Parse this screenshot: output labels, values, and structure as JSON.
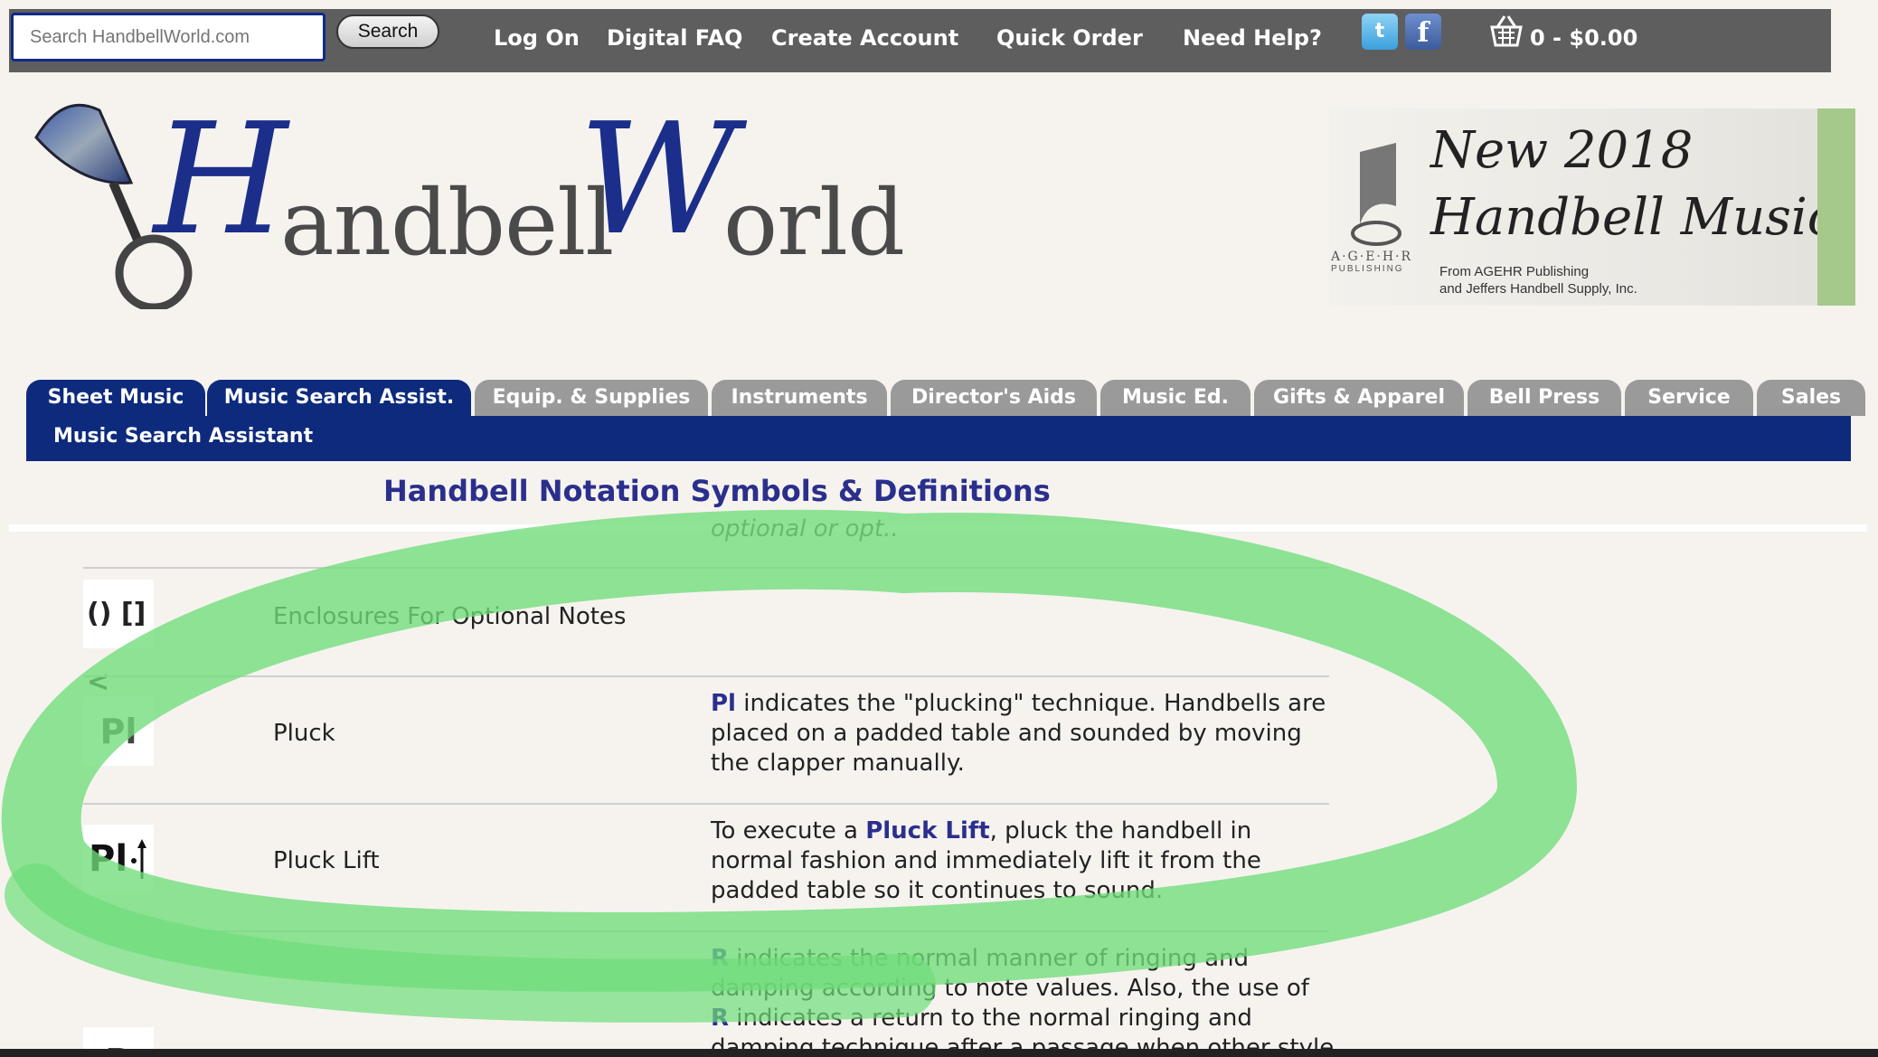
{
  "topbar": {
    "search_placeholder": "Search HandbellWorld.com",
    "search_button": "Search",
    "links": [
      "Log On",
      "Digital FAQ",
      "Create Account",
      "Quick Order",
      "Need Help?"
    ],
    "twitter_icon": "twitter-icon",
    "facebook_icon": "facebook-icon",
    "facebook_glyph": "f",
    "twitter_glyph": "t",
    "cart_icon": "shopping-basket-icon",
    "cart_summary": "0 - $0.00"
  },
  "logo": {
    "big_h": "H",
    "text1": "andbell",
    "big_w": "W",
    "text2": "orld"
  },
  "banner": {
    "line1": "New 2018",
    "line2": "Handbell Music",
    "sub1": "From AGEHR Publishing",
    "sub2": "and Jeffers Handbell Supply, Inc.",
    "publisher": "A·G·E·H·R",
    "publisher_sub": "PUBLISHING",
    "stripe_color": "#a5c98a"
  },
  "nav": {
    "tabs": [
      {
        "label": "Sheet Music",
        "active": true
      },
      {
        "label": "Music Search Assist.",
        "active": true
      },
      {
        "label": "Equip. & Supplies",
        "active": false
      },
      {
        "label": "Instruments",
        "active": false
      },
      {
        "label": "Director's Aids",
        "active": false
      },
      {
        "label": "Music Ed.",
        "active": false
      },
      {
        "label": "Gifts & Apparel",
        "active": false
      },
      {
        "label": "Bell Press",
        "active": false
      },
      {
        "label": "Service",
        "active": false
      },
      {
        "label": "Sales",
        "active": false
      }
    ],
    "subnav_label": "Music Search Assistant",
    "primary_color": "#0d2a7d"
  },
  "page": {
    "title": "Handbell Notation Symbols & Definitions",
    "cut_text": "optional or opt.."
  },
  "rows": [
    {
      "symbol": "() [] <",
      "name": "Enclosures For Optional Notes",
      "desc": ""
    },
    {
      "symbol": "Pl",
      "name": "Pluck",
      "desc_hl": "Pl",
      "desc_rest": " indicates the \"plucking\" technique. Handbells are placed on a padded table and sounded by moving the clapper manually."
    },
    {
      "symbol": "Pl",
      "name": "Pluck Lift",
      "desc_pre": "To execute a ",
      "desc_hl": "Pluck Lift",
      "desc_rest": ", pluck the handbell in normal fashion and immediately lift it from the padded table so it continues to sound."
    },
    {
      "symbol": "R",
      "name": "",
      "desc_hl": "R",
      "desc_mid": " indicates the normal manner of ringing and damping according to note values. Also, the use of ",
      "desc_hl2": "R",
      "desc_rest": " indicates a return to the normal ringing and damping technique after a passage when other style"
    }
  ],
  "annotation": {
    "stroke_color": "#6fdd7a"
  }
}
